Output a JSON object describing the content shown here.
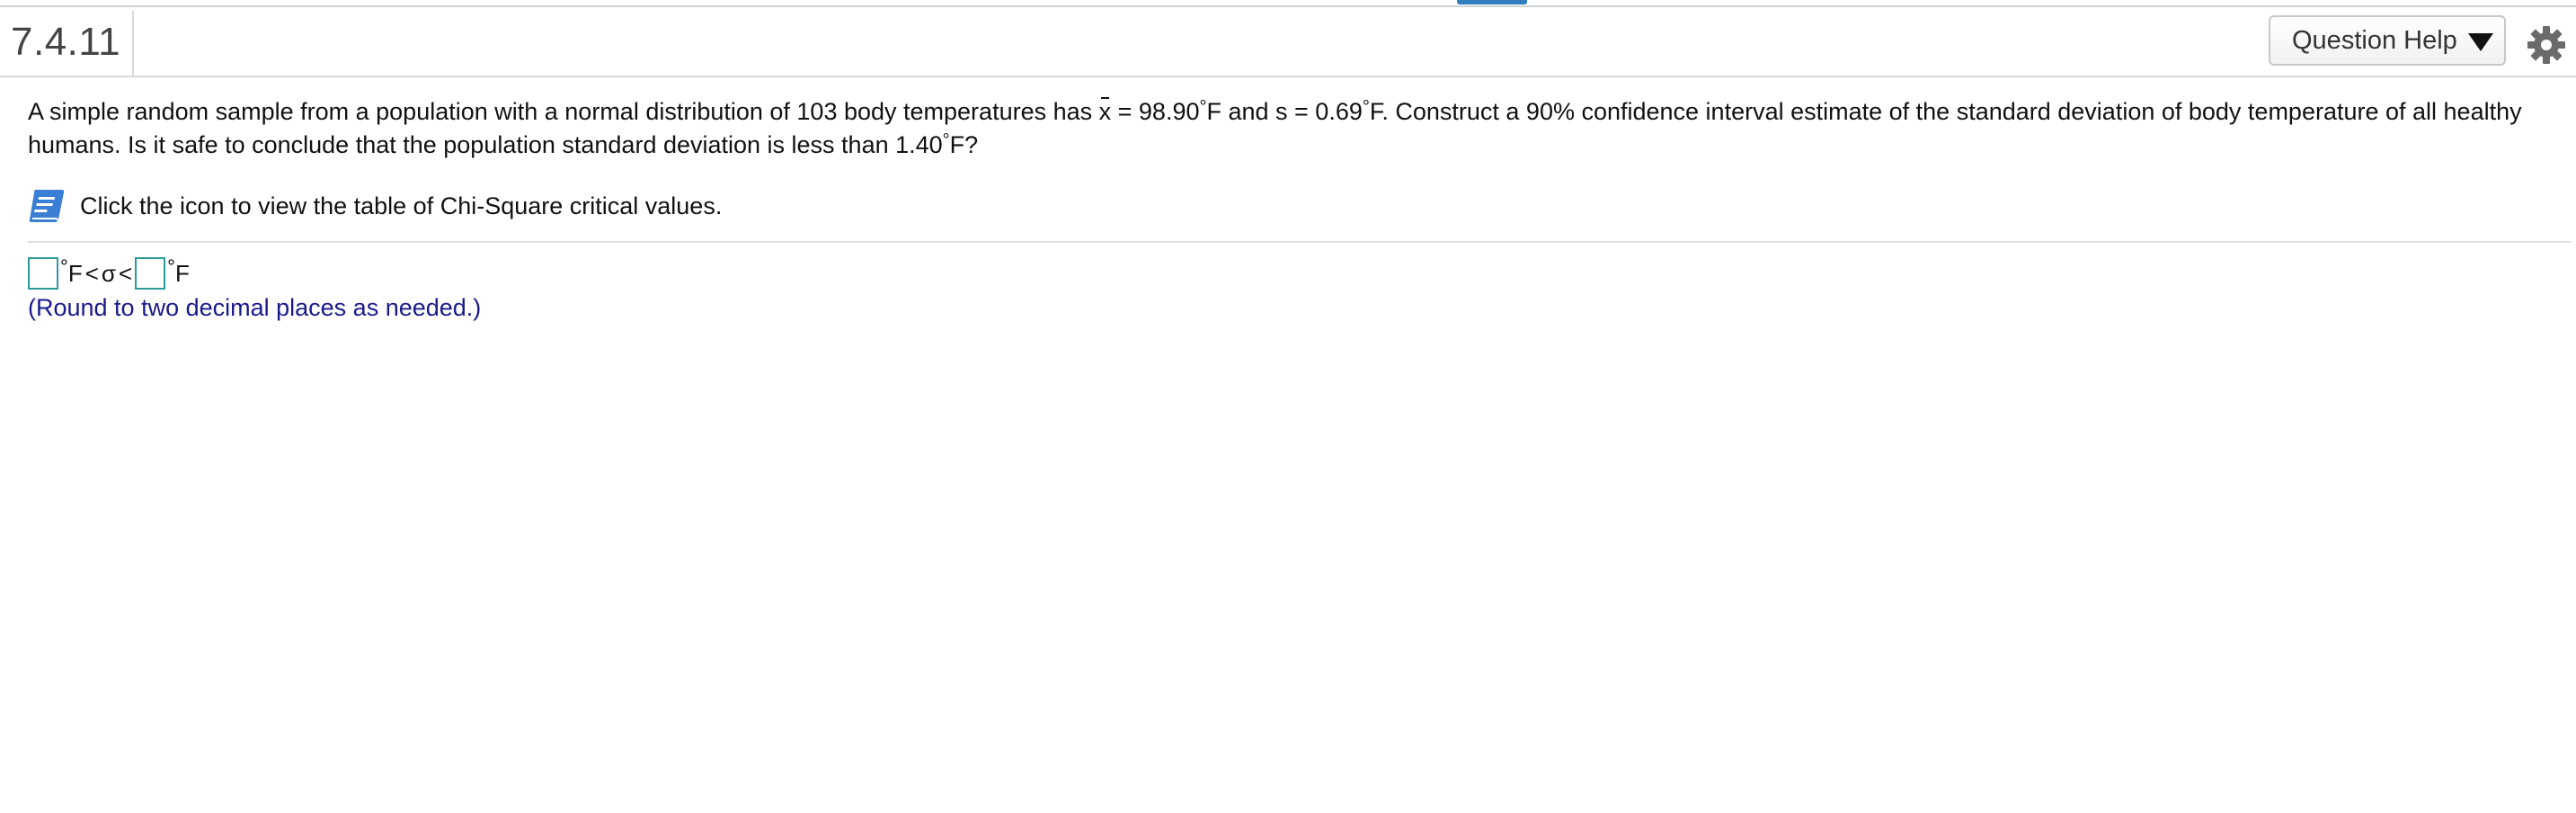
{
  "header": {
    "question_number": "7.4.11",
    "help_button_label": "Question Help"
  },
  "question": {
    "text_part1": "A simple random sample from a population with a normal distribution of 103 body temperatures has ",
    "xbar_symbol": "x",
    "text_part2": " = 98.90",
    "deg1": "°",
    "text_part3": "F and s = 0.69",
    "deg2": "°",
    "text_part4": "F. Construct a 90% confidence interval estimate of the standard deviation of body temperature of all healthy humans. Is it safe to conclude that the population standard deviation is less than 1.40",
    "deg3": "°",
    "text_part5": "F?"
  },
  "resource": {
    "label": "Click the icon to view the table of Chi-Square critical values."
  },
  "answer": {
    "lower_value": "",
    "upper_value": "",
    "deg_symbol": "°",
    "unit": "F",
    "less_than": "<",
    "sigma": "σ",
    "note": "(Round to two decimal places as needed.)"
  },
  "colors": {
    "accent_tab": "#2f7fc1",
    "answer_box_border": "#2b9a9a",
    "note_text": "#1a1a8c",
    "book_icon": "#3a7fd4"
  },
  "icons": {
    "settings": "gear-icon",
    "help_dropdown": "triangle-down-icon",
    "resource": "book-icon"
  }
}
